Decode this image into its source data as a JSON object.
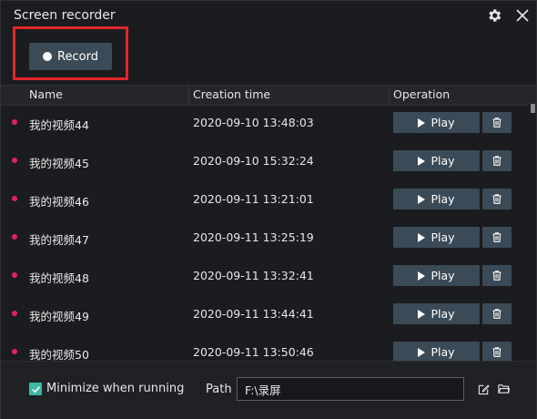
{
  "app": {
    "title": "Screen recorder"
  },
  "toolbar": {
    "record_label": "Record"
  },
  "table": {
    "headers": {
      "name": "Name",
      "creation_time": "Creation time",
      "operation": "Operation"
    },
    "rows": [
      {
        "name": "我的视频44",
        "time": "2020-09-10 13:48:03",
        "play_label": "Play"
      },
      {
        "name": "我的视频45",
        "time": "2020-09-10 15:32:24",
        "play_label": "Play"
      },
      {
        "name": "我的视频46",
        "time": "2020-09-11 13:21:01",
        "play_label": "Play"
      },
      {
        "name": "我的视频47",
        "time": "2020-09-11 13:25:19",
        "play_label": "Play"
      },
      {
        "name": "我的视频48",
        "time": "2020-09-11 13:32:41",
        "play_label": "Play"
      },
      {
        "name": "我的视频49",
        "time": "2020-09-11 13:44:41",
        "play_label": "Play"
      },
      {
        "name": "我的视频50",
        "time": "2020-09-11 13:50:46",
        "play_label": "Play"
      }
    ]
  },
  "footer": {
    "minimize_label": "Minimize when running",
    "minimize_checked": true,
    "path_label": "Path",
    "path_value": "F:\\录屏"
  },
  "colors": {
    "background": "#1b1c1f",
    "button": "#3a4a56",
    "row_dot": "#e0245e",
    "highlight": "#e2262b",
    "checkbox": "#3bb9a3"
  },
  "icons": [
    "gear-icon",
    "close-icon",
    "record-dot-icon",
    "play-icon",
    "trash-icon",
    "checkmark-icon",
    "edit-icon",
    "folder-icon"
  ]
}
